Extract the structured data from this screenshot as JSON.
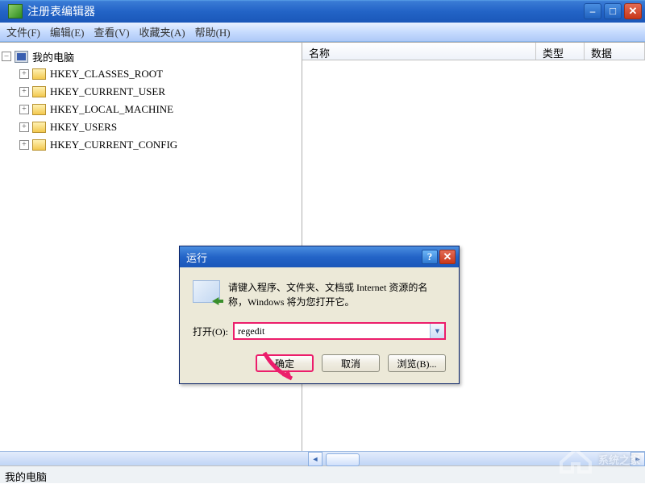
{
  "titlebar": {
    "title": "注册表编辑器"
  },
  "menus": {
    "file": "文件(F)",
    "edit": "编辑(E)",
    "view": "查看(V)",
    "favorites": "收藏夹(A)",
    "help": "帮助(H)"
  },
  "tree": {
    "root": "我的电脑",
    "items": [
      "HKEY_CLASSES_ROOT",
      "HKEY_CURRENT_USER",
      "HKEY_LOCAL_MACHINE",
      "HKEY_USERS",
      "HKEY_CURRENT_CONFIG"
    ]
  },
  "columns": {
    "name": "名称",
    "type": "类型",
    "data": "数据"
  },
  "statusbar": {
    "text": "我的电脑"
  },
  "dialog": {
    "title": "运行",
    "desc": "请键入程序、文件夹、文档或 Internet 资源的名称，Windows 将为您打开它。",
    "open_label": "打开(O):",
    "input_value": "regedit",
    "ok": "确定",
    "cancel": "取消",
    "browse": "浏览(B)..."
  },
  "watermark": {
    "text": "系统之家"
  }
}
